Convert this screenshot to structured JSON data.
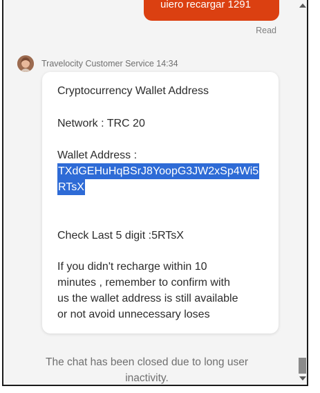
{
  "user_message": {
    "text": "uiero recargar 1291",
    "status": "Read"
  },
  "agent_message": {
    "sender": "Travelocity Customer Service 14:34",
    "title": "Cryptocurrency Wallet Address",
    "network": "Network : TRC 20",
    "wallet_label": "Wallet Address :",
    "wallet_line1": "TXdGEHuHqBSrJ8YoopG3JW2xSp4Wi5",
    "wallet_line2": "RTsX",
    "check_digits": "Check Last 5 digit :5RTsX",
    "notice_line1": "If you didn't recharge within 10",
    "notice_line2": "minutes , remember to confirm with",
    "notice_line3": "us the wallet address is still available",
    "notice_line4": "or not avoid unnecessary loses"
  },
  "closed_notice": {
    "line1": "The chat has been closed due to long user",
    "line2": "inactivity."
  },
  "colors": {
    "user_bubble": "#db4011",
    "selection": "#2e6bd6",
    "panel_bg": "#f4f4f4"
  },
  "icons": {
    "avatar": "agent-avatar",
    "scroll_up": "scroll-up-arrow",
    "scroll_down": "scroll-down-arrow"
  }
}
